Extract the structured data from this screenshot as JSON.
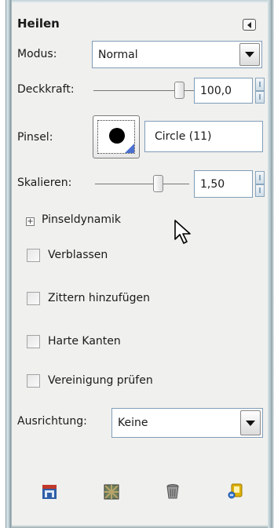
{
  "tool": {
    "title": "Heilen"
  },
  "mode": {
    "label": "Modus:",
    "value": "Normal"
  },
  "opacity": {
    "label": "Deckkraft:",
    "value": "100,0",
    "level": 1.0
  },
  "brush": {
    "label": "Pinsel:",
    "name": "Circle (11)"
  },
  "scale": {
    "label": "Skalieren:",
    "value": "1,50"
  },
  "dynamics": {
    "label": "Pinseldynamik",
    "expander": "+"
  },
  "checkboxes": [
    {
      "label": "Verblassen",
      "checked": false
    },
    {
      "label": "Zittern hinzufügen",
      "checked": false
    },
    {
      "label": "Harte Kanten",
      "checked": false
    },
    {
      "label": "Vereinigung prüfen",
      "checked": false
    }
  ],
  "alignment": {
    "label": "Ausrichtung:",
    "value": "Keine"
  },
  "toolbar": {
    "icons": [
      "save-preset-icon",
      "restore-preset-icon",
      "delete-preset-icon",
      "reset-icon"
    ],
    "colors": {
      "save": "#c0392b",
      "delete": "#8a8a8a",
      "reset": "#e0b000"
    }
  }
}
